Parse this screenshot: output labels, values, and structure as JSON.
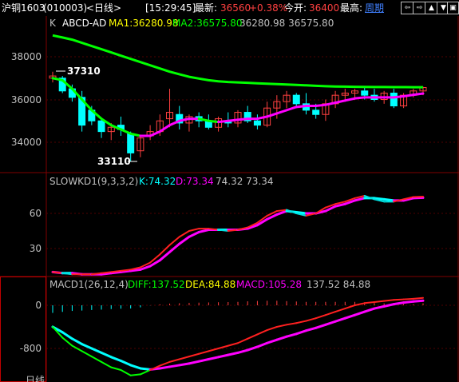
{
  "header": {
    "symbol": "沪铜1603",
    "code": "(010003)",
    "period": "<日线>",
    "time": "[15:29:45]",
    "last_label": "最新:",
    "last_value": "36560",
    "change_pct": "+0.38%",
    "open_label": "今开:",
    "open_value": "36400",
    "high_label": "最高:",
    "period_link": "周期",
    "nav_buttons": [
      "⇦",
      "⇨",
      "▲",
      "▼",
      "▣"
    ]
  },
  "colors": {
    "bg": "#000000",
    "up": "#ff4040",
    "down": "#00ffff",
    "ma1": "#ffffff",
    "ma2": "#00ff00",
    "grid": "#800000",
    "axis_text": "#c0c0c0",
    "accent": "#ffff00"
  },
  "main_panel": {
    "indicator": "K",
    "title": "ABCD-AD",
    "ma1": "MA1:36280.98",
    "ma2": "MA2:36575.80",
    "vals": "36280.98 36575.80",
    "high_mark": "37310",
    "low_mark": "33110",
    "y_ticks": [
      "38000",
      "36000",
      "34000"
    ]
  },
  "kd_panel": {
    "title": "SLOWKD1(9,3,3,2)",
    "k": "K:74.32",
    "d": "D:73.34",
    "vals": "74.32 73.34",
    "y_ticks": [
      "60",
      "30"
    ]
  },
  "macd_panel": {
    "title": "MACD1(26,12,4)",
    "diff": "DIFF:137.52",
    "dea": "DEA:84.88",
    "macd": "MACD:105.28",
    "vals": "137.52 84.88",
    "y_ticks": [
      "0",
      "-800"
    ]
  },
  "footer": {
    "label": "日线"
  },
  "chart_data": {
    "type": "candlestick",
    "high_marker": 37310,
    "low_marker": 33110,
    "ylim": [
      33000,
      39000
    ],
    "candles": [
      [
        37000,
        37300,
        36800,
        37100
      ],
      [
        37000,
        37100,
        36300,
        36400
      ],
      [
        36500,
        36700,
        35900,
        36100
      ],
      [
        36100,
        36400,
        34500,
        34800
      ],
      [
        35500,
        35700,
        34800,
        35000
      ],
      [
        35000,
        35100,
        34200,
        34500
      ],
      [
        34500,
        34900,
        34100,
        34700
      ],
      [
        34800,
        35200,
        34300,
        34600
      ],
      [
        34400,
        34500,
        33100,
        33500
      ],
      [
        33600,
        34300,
        33300,
        34200
      ],
      [
        34300,
        34800,
        34100,
        34500
      ],
      [
        34500,
        35300,
        34300,
        35000
      ],
      [
        35100,
        36500,
        34700,
        35400
      ],
      [
        35300,
        35700,
        34600,
        34900
      ],
      [
        34900,
        35300,
        34500,
        35200
      ],
      [
        35200,
        35400,
        34700,
        35000
      ],
      [
        35000,
        35300,
        34600,
        34700
      ],
      [
        34700,
        35200,
        34500,
        35100
      ],
      [
        35000,
        35400,
        34700,
        34900
      ],
      [
        34900,
        35500,
        34700,
        35400
      ],
      [
        35400,
        35700,
        34900,
        35000
      ],
      [
        35000,
        35300,
        34600,
        34800
      ],
      [
        34800,
        35900,
        34700,
        35600
      ],
      [
        35600,
        36200,
        35100,
        35900
      ],
      [
        35900,
        36400,
        35600,
        36200
      ],
      [
        36200,
        36300,
        35700,
        35800
      ],
      [
        35800,
        36300,
        35300,
        35500
      ],
      [
        35500,
        35800,
        35100,
        35300
      ],
      [
        35300,
        36000,
        35000,
        35800
      ],
      [
        35800,
        36400,
        35600,
        36200
      ],
      [
        36200,
        36500,
        35900,
        36300
      ],
      [
        36300,
        36500,
        36000,
        36400
      ],
      [
        36400,
        36600,
        36000,
        36200
      ],
      [
        36200,
        36500,
        35900,
        36000
      ],
      [
        36000,
        36400,
        35800,
        36300
      ],
      [
        36300,
        36500,
        35600,
        35700
      ],
      [
        35700,
        36300,
        35600,
        36200
      ],
      [
        36200,
        36500,
        36100,
        36400
      ],
      [
        36400,
        36600,
        36200,
        36560
      ]
    ],
    "ma1": [
      37000,
      36900,
      36500,
      36000,
      35500,
      35100,
      34800,
      34600,
      34400,
      34300,
      34300,
      34500,
      34800,
      35000,
      35100,
      35100,
      35000,
      34950,
      35000,
      35050,
      35100,
      35100,
      35200,
      35350,
      35500,
      35650,
      35700,
      35700,
      35750,
      35850,
      35950,
      36050,
      36100,
      36100,
      36100,
      36100,
      36150,
      36220,
      36281
    ],
    "ma2": [
      39000,
      38900,
      38800,
      38650,
      38500,
      38350,
      38200,
      38050,
      37900,
      37750,
      37600,
      37450,
      37300,
      37180,
      37060,
      36980,
      36900,
      36850,
      36820,
      36800,
      36780,
      36760,
      36740,
      36720,
      36700,
      36680,
      36660,
      36640,
      36620,
      36610,
      36600,
      36595,
      36590,
      36585,
      36582,
      36580,
      36578,
      36577,
      36576
    ],
    "k": [
      10,
      9,
      8,
      8,
      8,
      9,
      10,
      11,
      12,
      14,
      18,
      25,
      33,
      40,
      45,
      47,
      47,
      46,
      45,
      46,
      48,
      52,
      58,
      62,
      63,
      60,
      58,
      60,
      65,
      68,
      70,
      73,
      75,
      72,
      70,
      70,
      72,
      74,
      74.32
    ],
    "d": [
      10,
      9,
      9,
      8,
      8,
      8,
      9,
      10,
      11,
      12,
      15,
      20,
      27,
      34,
      40,
      44,
      46,
      46,
      46,
      46,
      47,
      50,
      55,
      59,
      62,
      61,
      60,
      60,
      62,
      66,
      68,
      71,
      73,
      73,
      72,
      71,
      71,
      73,
      73.34
    ],
    "diff": [
      -400,
      -600,
      -750,
      -850,
      -950,
      -1050,
      -1150,
      -1200,
      -1300,
      -1280,
      -1200,
      -1120,
      -1050,
      -1000,
      -950,
      -900,
      -850,
      -800,
      -750,
      -700,
      -620,
      -540,
      -460,
      -400,
      -360,
      -330,
      -290,
      -240,
      -180,
      -120,
      -60,
      0,
      40,
      60,
      80,
      100,
      110,
      120,
      137.52
    ],
    "dea": [
      -400,
      -500,
      -620,
      -720,
      -800,
      -880,
      -960,
      -1030,
      -1110,
      -1170,
      -1190,
      -1170,
      -1140,
      -1110,
      -1080,
      -1040,
      -1000,
      -960,
      -920,
      -880,
      -830,
      -770,
      -700,
      -640,
      -580,
      -530,
      -470,
      -420,
      -360,
      -300,
      -240,
      -180,
      -120,
      -60,
      -20,
      20,
      50,
      70,
      84.88
    ],
    "macd_bars": [
      -400,
      -350,
      -300,
      -280,
      -250,
      -230,
      -200,
      -180,
      -170,
      -110,
      -10,
      50,
      90,
      110,
      130,
      140,
      150,
      160,
      170,
      180,
      210,
      230,
      240,
      240,
      220,
      200,
      180,
      180,
      180,
      180,
      180,
      180,
      160,
      120,
      100,
      80,
      60,
      50,
      105.28
    ]
  }
}
